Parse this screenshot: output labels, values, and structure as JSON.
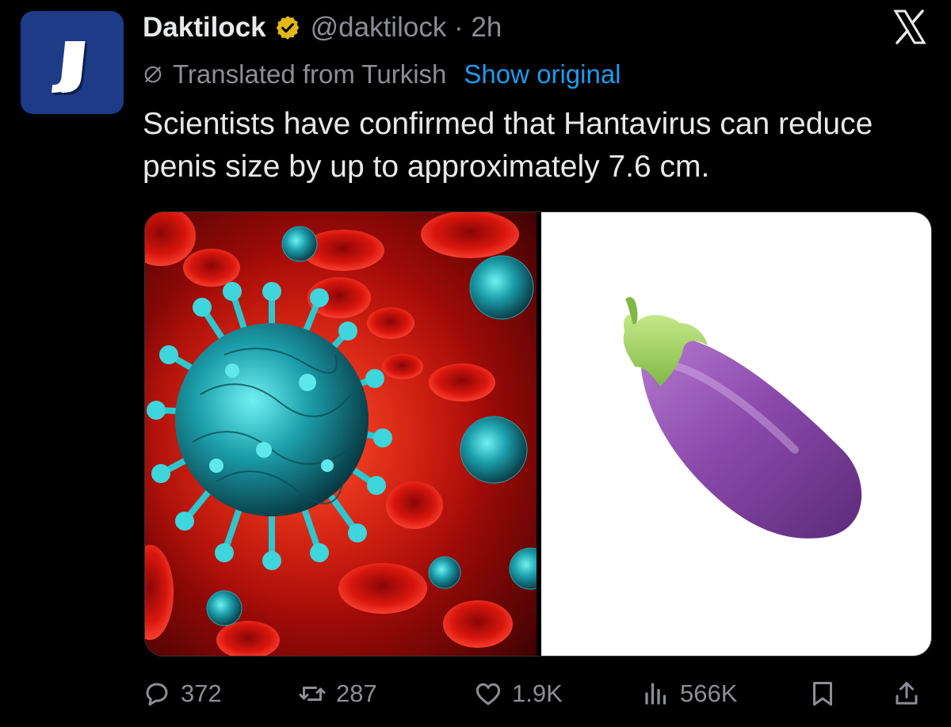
{
  "tweet": {
    "author": {
      "display_name": "Daktilock",
      "handle_and_time": "@daktilock · 2h",
      "verified_badge": "gold-verified-icon",
      "avatar_icon": "daktilock-logo-icon",
      "avatar_color": "#1d3b86"
    },
    "translation": {
      "label": "Translated from Turkish",
      "show_original": "Show original",
      "icon": "globe-icon"
    },
    "text": "Scientists have confirmed that Hantavirus can reduce penis size by up to approximately 7.6 cm.",
    "media": [
      {
        "name": "virus-illustration",
        "description_icon": "virus-among-red-blood-cells"
      },
      {
        "name": "eggplant-emoji",
        "description_icon": "eggplant-icon"
      }
    ],
    "actions": {
      "replies": "372",
      "reposts": "287",
      "likes": "1.9K",
      "views": "566K",
      "bookmark_icon": "bookmark-icon",
      "share_icon": "share-icon"
    }
  },
  "app": {
    "logo_icon": "x-logo-icon"
  },
  "colors": {
    "background": "#000000",
    "primary_text": "#e7e9ea",
    "secondary_text": "#8b8f94",
    "link": "#1d9bf0",
    "verified_gold": "#e2b719"
  }
}
